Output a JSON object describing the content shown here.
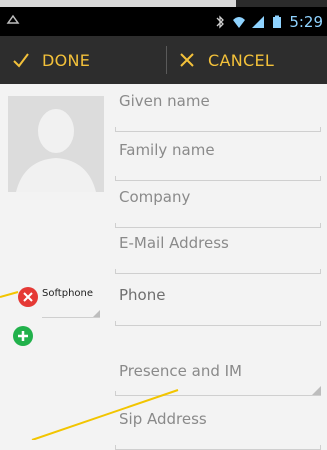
{
  "toolbar": {
    "done_label": "DONE",
    "cancel_label": "CANCEL",
    "accent_color": "#f3c13a"
  },
  "status_bar": {
    "time": "5:29",
    "icons": [
      "notification-icon",
      "bluetooth-icon",
      "wifi-icon",
      "signal-icon",
      "battery-icon"
    ]
  },
  "form": {
    "given_name": "Given name",
    "family_name": "Family name",
    "company": "Company",
    "email": "E-Mail Address",
    "phone_type": "Softphone",
    "phone": "Phone",
    "presence": "Presence and IM",
    "sip": "Sip Address"
  },
  "icons": {
    "remove": "remove-field-icon",
    "add": "add-field-icon",
    "avatar": "contact-photo-placeholder"
  }
}
